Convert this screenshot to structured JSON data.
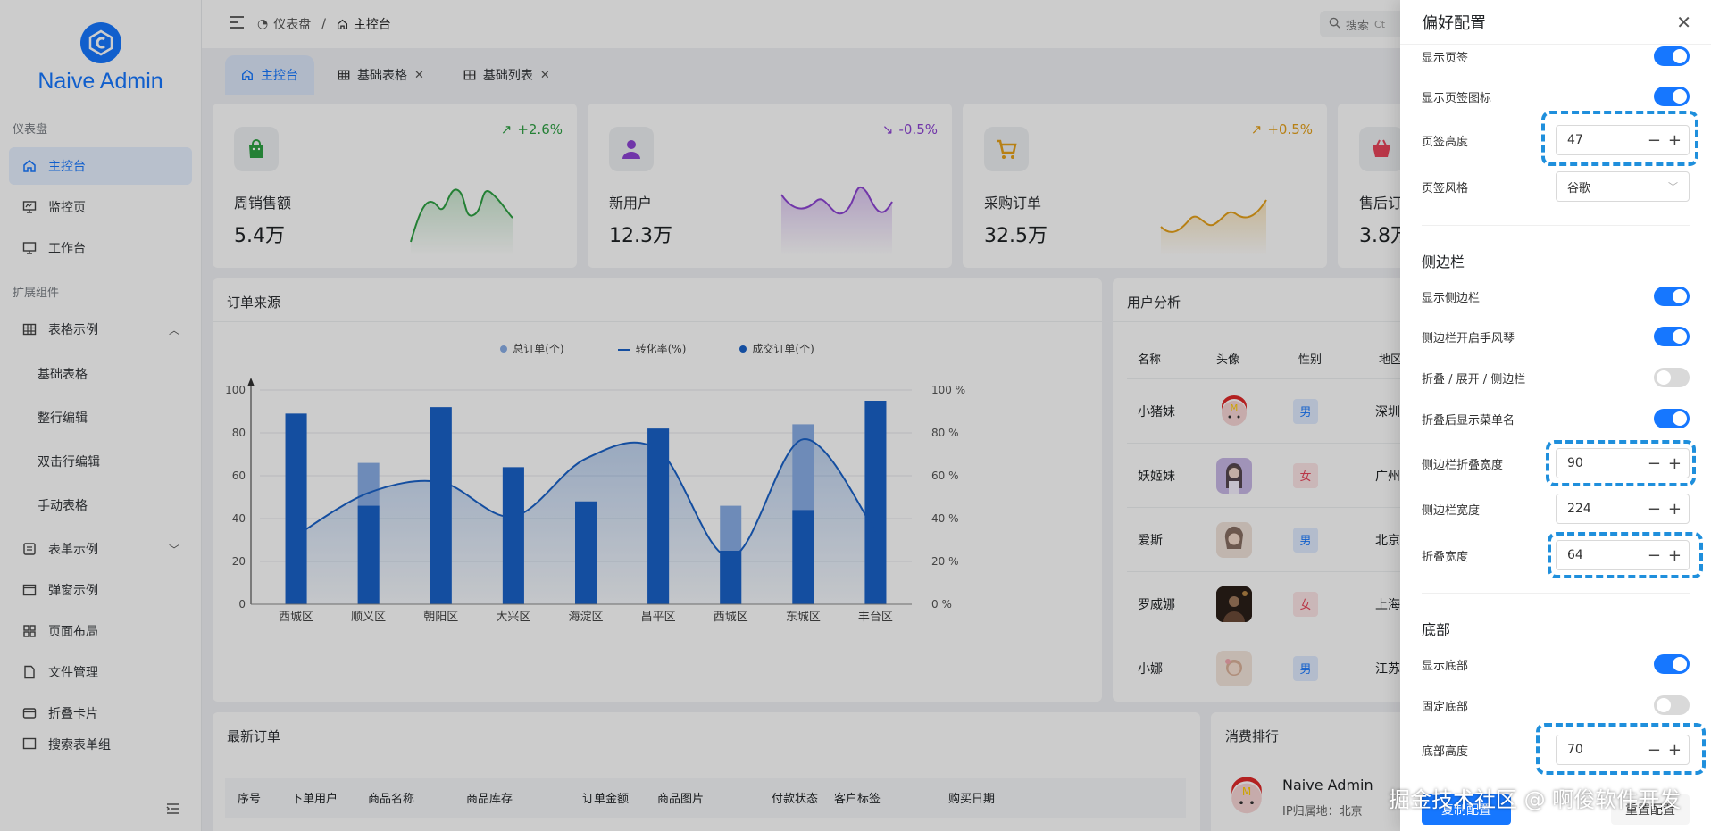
{
  "app": {
    "logo_text": "Naive Admin"
  },
  "sidebar": {
    "group_dashboard": "仪表盘",
    "item_home": "主控台",
    "item_monitor": "监控页",
    "item_workbench": "工作台",
    "group_components": "扩展组件",
    "item_table_examples": "表格示例",
    "sub_basic_table": "基础表格",
    "sub_row_edit": "整行编辑",
    "sub_dblclick_edit": "双击行编辑",
    "sub_manual_table": "手动表格",
    "item_form_examples": "表单示例",
    "item_modal_examples": "弹窗示例",
    "item_page_layout": "页面布局",
    "item_file_manage": "文件管理",
    "item_fold_card": "折叠卡片",
    "item_search_form": "搜索表单组"
  },
  "header": {
    "crumb_dashboard": "仪表盘",
    "crumb_sep": "/",
    "crumb_home": "主控台",
    "search_placeholder": "搜索",
    "search_shortcut": "Ct"
  },
  "tabs": [
    {
      "label": "主控台"
    },
    {
      "label": "基础表格"
    },
    {
      "label": "基础列表"
    }
  ],
  "stats": [
    {
      "label": "周销售额",
      "value": "5.4万",
      "trend": "+2.6%",
      "color": "#2ea043"
    },
    {
      "label": "新用户",
      "value": "12.3万",
      "trend": "-0.5%",
      "color": "#8e44d4"
    },
    {
      "label": "采购订单",
      "value": "32.5万",
      "trend": "+0.5%",
      "color": "#e5a019"
    },
    {
      "label": "售后订",
      "value": "3.8万"
    }
  ],
  "order_source": {
    "title": "订单来源",
    "legend": [
      "总订单(个)",
      "转化率(%)",
      "成交订单(个)"
    ]
  },
  "chart_data": {
    "type": "bar",
    "categories": [
      "西城区",
      "顺义区",
      "朝阳区",
      "大兴区",
      "海淀区",
      "昌平区",
      "西城区",
      "东城区",
      "丰台区"
    ],
    "series": [
      {
        "name": "总订单(个)",
        "values": [
          89,
          66,
          92,
          64,
          48,
          82,
          46,
          84,
          95
        ]
      },
      {
        "name": "成交订单(个)",
        "values": [
          89,
          46,
          92,
          64,
          48,
          82,
          25,
          44,
          95
        ]
      },
      {
        "name": "转化率(%)",
        "values": [
          32,
          52,
          57,
          41,
          68,
          72,
          22,
          77,
          34
        ]
      }
    ],
    "left_ticks": [
      "0",
      "20",
      "40",
      "60",
      "80",
      "100"
    ],
    "right_ticks": [
      "0 %",
      "20 %",
      "40 %",
      "60 %",
      "80 %",
      "100 %"
    ],
    "ylim": [
      0,
      100
    ],
    "colors": {
      "bar": "#1a62c8",
      "bar_light": "#8aaee6",
      "line": "#1a62c8"
    }
  },
  "user_analysis": {
    "title": "用户分析",
    "columns": [
      "名称",
      "头像",
      "性别",
      "地区"
    ],
    "rows": [
      {
        "name": "小猪妹",
        "gender": "男",
        "region": "深圳"
      },
      {
        "name": "妖姬妹",
        "gender": "女",
        "region": "广州"
      },
      {
        "name": "爱斯",
        "gender": "男",
        "region": "北京"
      },
      {
        "name": "罗威娜",
        "gender": "女",
        "region": "上海"
      },
      {
        "name": "小娜",
        "gender": "男",
        "region": "江苏"
      }
    ]
  },
  "latest_orders": {
    "title": "最新订单",
    "columns": [
      "序号",
      "下单用户",
      "商品名称",
      "商品库存",
      "订单金额",
      "商品图片",
      "付款状态",
      "客户标签",
      "购买日期"
    ]
  },
  "ranking": {
    "title": "消费排行",
    "name": "Naive Admin",
    "ip": "IP归属地：北京"
  },
  "drawer": {
    "title": "偏好配置",
    "show_tabs": "显示页签",
    "show_tab_icon": "显示页签图标",
    "tab_height": "页签高度",
    "tab_height_value": "47",
    "tab_style": "页签风格",
    "tab_style_value": "谷歌",
    "section_sidebar": "侧边栏",
    "show_sidebar": "显示侧边栏",
    "sidebar_accordion": "侧边栏开启手风琴",
    "sidebar_collapse": "折叠 / 展开 / 侧边栏",
    "collapse_show_name": "折叠后显示菜单名",
    "sidebar_collapse_width": "侧边栏折叠宽度",
    "sidebar_collapse_width_value": "90",
    "sidebar_width": "侧边栏宽度",
    "sidebar_width_value": "224",
    "fold_width": "折叠宽度",
    "fold_width_value": "64",
    "section_footer": "底部",
    "show_footer": "显示底部",
    "fixed_footer": "固定底部",
    "footer_height": "底部高度",
    "footer_height_value": "70",
    "copy_btn": "复制配置",
    "reset_btn": "重置配置"
  },
  "watermark": "掘金技术社区 @ 啊俊软件开发"
}
